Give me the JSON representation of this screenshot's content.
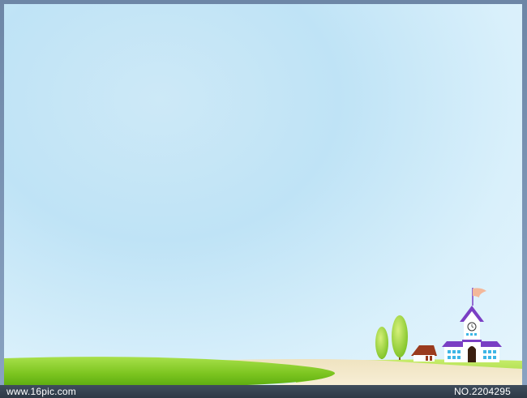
{
  "watermark": {
    "site": "www.16pic.com",
    "number": "NO.2204295"
  },
  "colors": {
    "sky_top": "#cde9f7",
    "sky_bottom": "#e6f5fd",
    "grass": "#8fd230",
    "road": "#f3e7c6",
    "roof": "#7a3fc4",
    "walls": "#ffffff",
    "windows": "#3db6e6",
    "tree": "#9ad43a",
    "house_roof": "#9a3b1e"
  },
  "icons": [
    "tree-icon",
    "house-icon",
    "school-icon",
    "flag-icon",
    "clock-icon"
  ]
}
